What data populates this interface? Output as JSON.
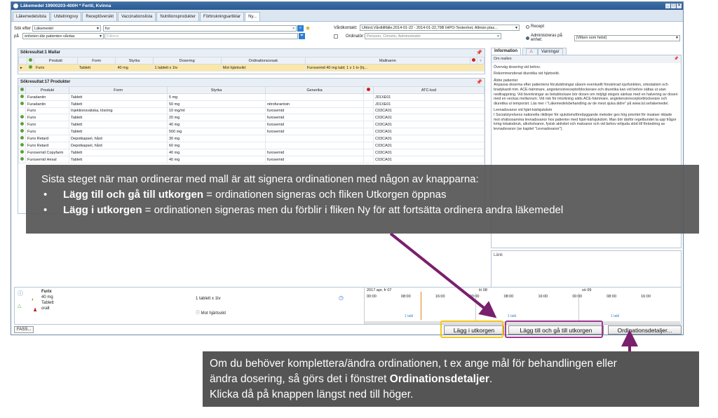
{
  "window": {
    "title": "Läkemedel 19900203-400H * Fertil, Kvinna"
  },
  "tabs": [
    "Läkemedelslista",
    "Utdelningsvy",
    "Receptöversikt",
    "Vaccinationslista",
    "Nutritionsprodukter",
    "Förbrukningsartiklar",
    "Ny..."
  ],
  "search": {
    "sok_efter_label": "Sök efter",
    "sok_efter_value": "Läkemedel",
    "query": "fur",
    "pa_label": "på",
    "pa_value": "enheten där patienten vårdas",
    "filter_placeholder": "Filtrera",
    "vardkontakt_label": "Vårdkontakt:",
    "vardkontakt_value": "Uttörd,Vårdtillfälle,2014-01-22 - 2014-01-22,79B IHPO-Testenhet, Allmän plas...",
    "ordinator_label": "Ordinatör:",
    "ordinator_value": "Persson, Christin, Administratör",
    "recept_label": "Recept",
    "admin_label": "Administreras på enhet:",
    "admin_value": "(Vilken som helst)"
  },
  "mallar": {
    "title": "Sökresultat:1 Mallar",
    "headers": [
      "Produkt",
      "Form",
      "Styrka",
      "Dosering",
      "Ordinationsorsak",
      "Mallnamn"
    ],
    "rows": [
      [
        "Furix",
        "Tablett",
        "40 mg",
        "1 tablett x 1tv",
        "Mot hjärtsvikt",
        "Furosemid 40 mg tabl; 1 x 1 tv (hj..."
      ]
    ]
  },
  "produkter": {
    "title": "Sökresultat:17 Produkter",
    "headers": [
      "Produkt",
      "Form",
      "Styrka",
      "Generika",
      "ATC-kod"
    ],
    "rows": [
      [
        "Furadantin",
        "Tablett",
        "5 mg",
        "",
        "J01XE01"
      ],
      [
        "Furadantin",
        "Tablett",
        "50 mg",
        "nitrofurantoin",
        "J01XE01"
      ],
      [
        "Furix",
        "Injektionsvätska, lösning",
        "10 mg/ml",
        "furosemid",
        "C03CA01"
      ],
      [
        "Furix",
        "Tablett",
        "20 mg",
        "furosemid",
        "C03CA01"
      ],
      [
        "Furix",
        "Tablett",
        "40 mg",
        "furosemid",
        "C03CA01"
      ],
      [
        "Furix",
        "Tablett",
        "500 mg",
        "furosemid",
        "C03CA01"
      ],
      [
        "Furix Retard",
        "Depotkapsel, hård",
        "30 mg",
        "",
        "C03CA01"
      ],
      [
        "Furix Retard",
        "Depotkapsel, hård",
        "60 mg",
        "",
        "C03CA01"
      ],
      [
        "Furosemid Copyfarm",
        "Tablett",
        "40 mg",
        "furosemid",
        "C03CA01"
      ],
      [
        "Furosemid Hexal",
        "Tablett",
        "40 mg",
        "furosemid",
        "C03CA01"
      ]
    ]
  },
  "info": {
    "tab_info": "Information",
    "tab_varningar": "Varningar",
    "om_mallen": "Om mallen",
    "p1": "Överväg dosering vid behov.",
    "p2": "Rekommenderad diuretika vid hjärtsvikt.",
    "p3": "Äldre patienter",
    "p4": "Anpassa doserna efter patientens förutsättningar såsom eventuellt försämrad njurfunktion, ortostatism och bradykardi mm. ACE-hämmare, angiotensinreceptorblockerare och diuretika kan vid behov sättas ut utan nedtrappning. Vid biverkningar av betablockare bör dosen om möjligt stegvis sänkas med en halvering av dosen med en veckas mellanrum. Vid risk för intorkning sätts ACE-hämmare, angiotensinreceptorblockerare och diuretika ut temporärt. Läs mer i \"Läkemedelsbehandling av de mest sjuka äldre\" på www.lul.se/lakemedel.",
    "p5": "Levnadsvanor vid hjärt-kärlsjukdom",
    "p6": "I Socialstyrelsens nationella riktlinjer för sjukdomsförebyggande metoder ges hög prioritet för insatser riktade mot ohälsosamma levnadsvanor hos patienter med hjärt-kärlsjukdom. Man bör därför regelbundet ta upp frågor kring tobaksbruk, alkoholvanor, fysisk aktivitet och matvanor och vid behov erbjuda stöd till förändring av levnadsvanor (se kapitel \"Levnadsvanor\").",
    "lank": "Länk"
  },
  "ordination": {
    "product": "Furix",
    "strength": "40 mg",
    "form": "Tablett",
    "route": "oralt",
    "dosage": "1 tablett x 1tv",
    "reason": "Mot hjärtsvikt",
    "timeline_date1": "2017 apr, fr 07",
    "timeline_date2": "lö 08",
    "timeline_date3": "sö 09",
    "times": [
      "00:00",
      "08:00",
      "16:00",
      "00:00",
      "08:00",
      "16:00",
      "00:00",
      "08:00",
      "16:00"
    ],
    "dose_label": "1 tabl"
  },
  "buttons": {
    "fass": "FASS...",
    "lagg_i_utkorgen": "Lägg i utkorgen",
    "lagg_till_ga": "Lägg till och gå till utkorgen",
    "ordinationsdetaljer": "Ordinationsdetaljer..."
  },
  "callout_top": {
    "intro": "Sista steget när man ordinerar med mall är att signera ordinationen med någon av knapparna:",
    "item1_bold": "Lägg till och gå till utkorgen",
    "item1_rest": " = ordinationen signeras och fliken Utkorgen öppnas",
    "item2_bold": "Lägg i utkorgen",
    "item2_rest": " = ordinationen signeras men du förblir i fliken Ny för att fortsätta ordinera andra läkemedel"
  },
  "callout_bottom": {
    "line1": "Om du behöver komplettera/ändra ordinationen, t ex ange mål för behandlingen eller",
    "line2_pre": "ändra dosering, så görs det i fönstret ",
    "line2_bold": "Ordinationsdetaljer",
    "line2_post": ".",
    "line3": "Klicka då på knappen längst ned till höger."
  },
  "colors": {
    "yellow_frame": "#f5c518",
    "purple_frame": "#a0388f",
    "arrow": "#7a1f6e",
    "callout_bg": "#555555"
  }
}
